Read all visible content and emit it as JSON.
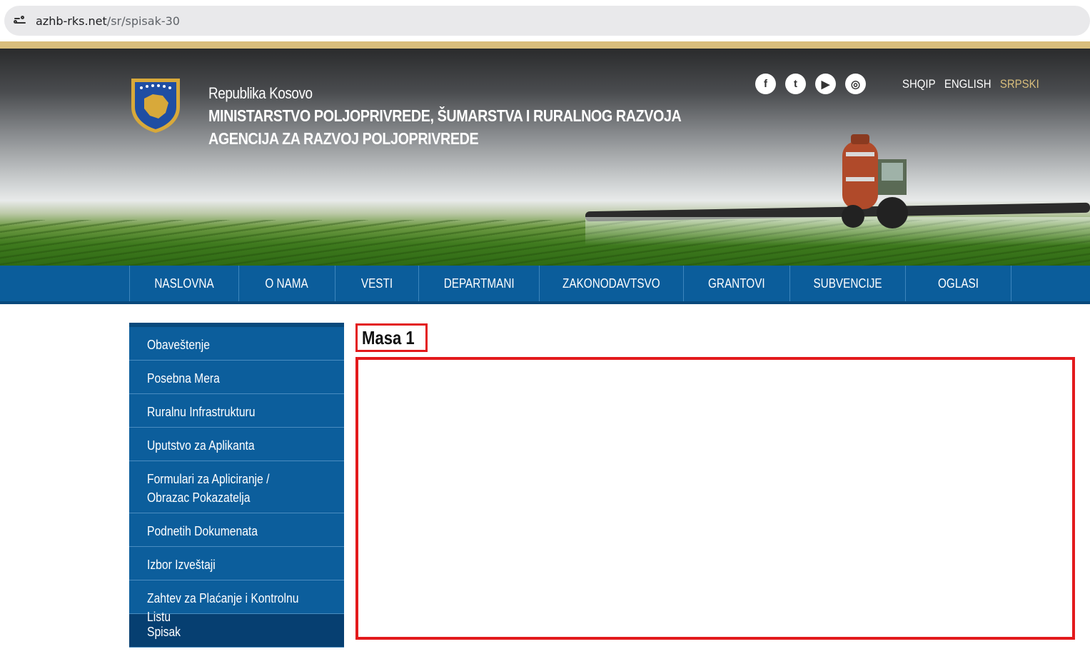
{
  "browser": {
    "url_host": "azhb-rks.net",
    "url_path": "/sr/spisak-30"
  },
  "header": {
    "line1": "Republika Kosovo",
    "line2": "MINISTARSTVO POLJOPRIVREDE, ŠUMARSTVA I RURALNOG RAZVOJA",
    "line3": "AGENCIJA ZA RAZVOJ POLJOPRIVREDE",
    "social": [
      {
        "icon": "facebook-icon",
        "glyph": "f"
      },
      {
        "icon": "twitter-icon",
        "glyph": "t"
      },
      {
        "icon": "youtube-icon",
        "glyph": "▶"
      },
      {
        "icon": "instagram-icon",
        "glyph": "◎"
      }
    ],
    "languages": [
      "SHQIP",
      "ENGLISH",
      "SRPSKI"
    ],
    "active_language": "SRPSKI"
  },
  "nav": {
    "items": [
      "NASLOVNA",
      "O NAMA",
      "VESTI",
      "DEPARTMANI",
      "ZAKONODAVTSVO",
      "GRANTOVI",
      "SUBVENCIJE",
      "OGLASI"
    ]
  },
  "sidebar": {
    "items": [
      "Obaveštenje",
      "Posebna Mera",
      "Ruralnu Infrastrukturu",
      "Uputstvo za Aplikanta",
      "Formulari za Apliciranje / Obrazac Pokazatelja",
      "Podnetih Dokumenata",
      "Izbor Izveštaji",
      "Zahtev za Plaćanje i Kontrolnu Listu",
      "Spisak"
    ],
    "active_item": "Spisak"
  },
  "main": {
    "heading": "Masa 1"
  },
  "colors": {
    "nav_blue": "#0b5d9b",
    "sidebar_active": "#063f71",
    "gold": "#d8bd7c",
    "highlight_red": "#e31a1c"
  }
}
